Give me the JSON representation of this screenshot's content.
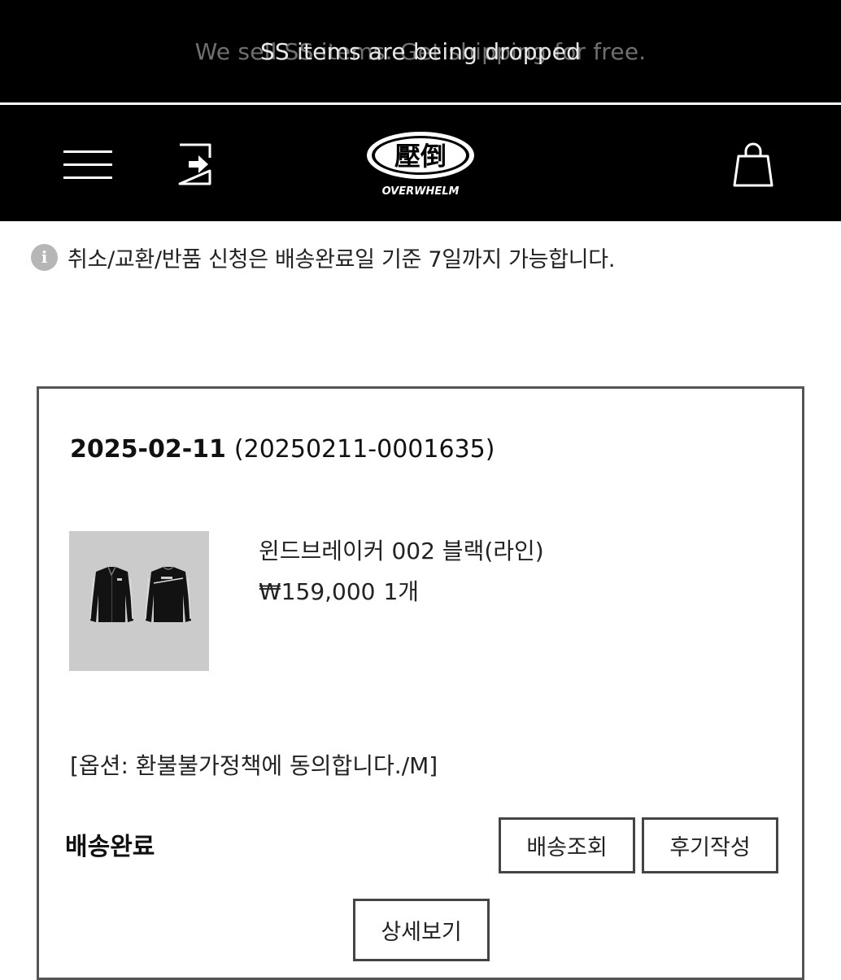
{
  "announcement": {
    "ghost_text": "We sell SS items. Get shipping for free.",
    "main_text": "SS items are being dropped"
  },
  "header": {
    "logo": {
      "glyphs": "壓倒",
      "text": "OVERWHELM"
    },
    "icons": {
      "menu": "hamburger-menu-icon",
      "login": "login-arrow-icon",
      "cart": "shopping-bag-icon"
    }
  },
  "notice": {
    "icon": "info-icon",
    "icon_glyph": "i",
    "text": "취소/교환/반품 신청은 배송완료일 기준 7일까지 가능합니다."
  },
  "order": {
    "date": "2025-02-11",
    "order_number": "(20250211-0001635)",
    "product": {
      "name": "윈드브레이커 002 블랙(라인)",
      "price": "₩159,000",
      "quantity": "1개",
      "option": "[옵션: 환불불가정책에 동의합니다./M]"
    },
    "status": "배송완료",
    "buttons": {
      "track": "배송조회",
      "review": "후기작성",
      "detail": "상세보기"
    }
  },
  "colors": {
    "header_bg": "#000000",
    "page_bg": "#ffffff",
    "card_border": "#555555",
    "thumb_bg": "#cbcbcb",
    "info_icon_bg": "#b6b6b6"
  }
}
